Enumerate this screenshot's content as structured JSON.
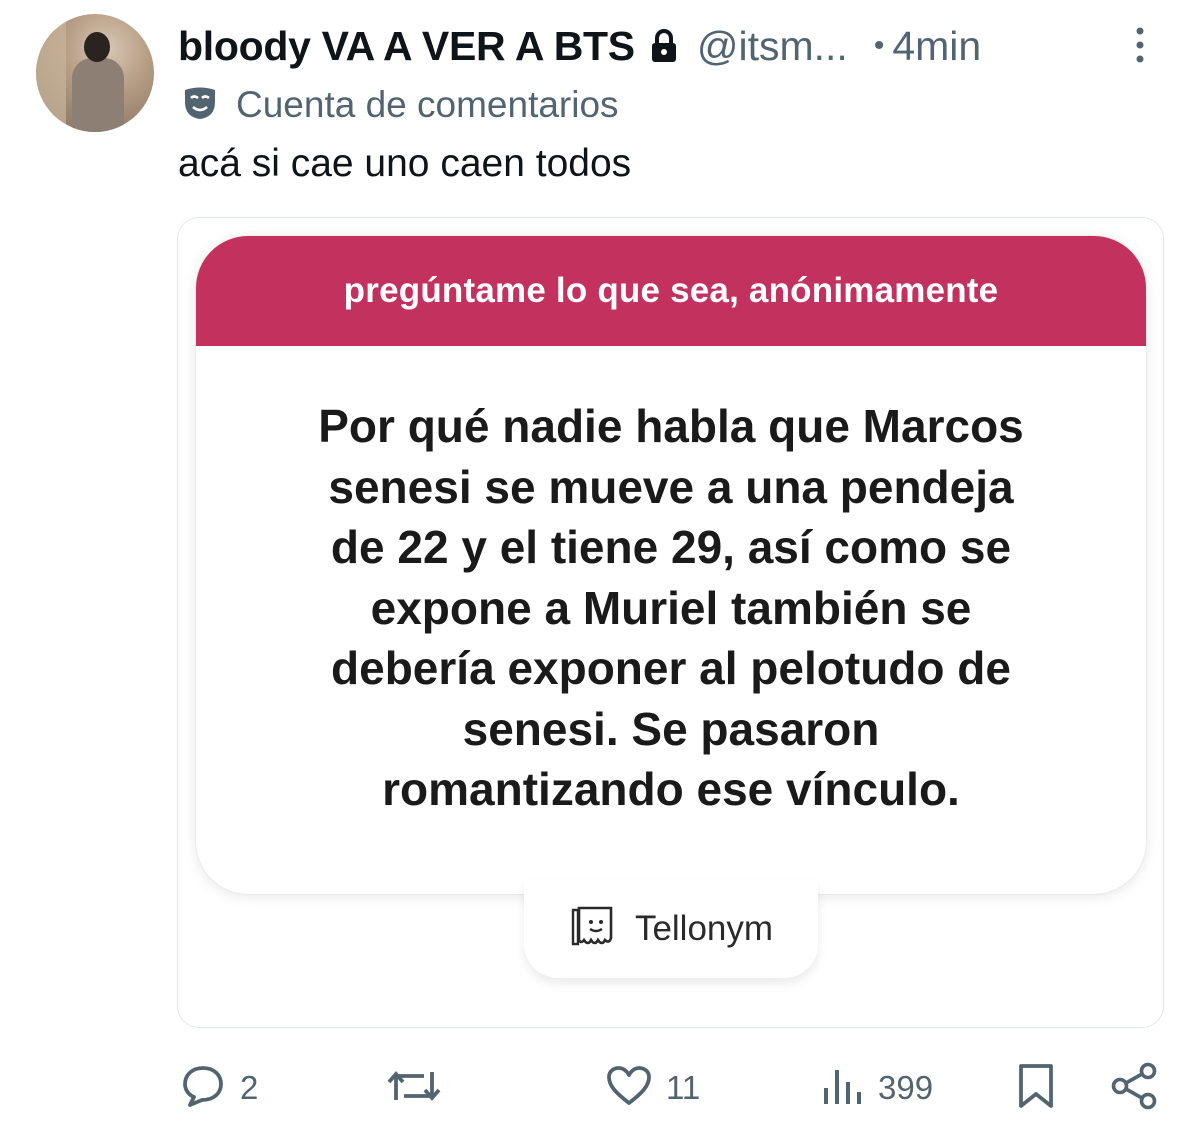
{
  "tweet": {
    "display_name": "bloody VA A VER A BTS",
    "handle": "@itsm...",
    "separator": "•",
    "time": "4min",
    "account_label": "Cuenta de comentarios",
    "text": "acá si cae uno caen todos"
  },
  "tellonym": {
    "banner": "pregúntame lo que sea, anónimamente",
    "question_lines": [
      "Por qué nadie habla que Marcos",
      "senesi se mueve a una pendeja",
      "de 22 y el tiene 29, así como se",
      "expone a Muriel también se",
      "debería exponer al pelotudo de",
      "senesi. Se pasaron",
      "romantizando ese vínculo."
    ],
    "brand": "Tellonym"
  },
  "actions": {
    "replies": "2",
    "retweets": "",
    "likes": "11",
    "views": "399"
  },
  "icons": [
    "lock-icon",
    "more-icon",
    "mask-icon",
    "tellonym-logo-icon",
    "reply-icon",
    "retweet-icon",
    "like-icon",
    "views-icon",
    "bookmark-icon",
    "share-icon"
  ],
  "colors": {
    "banner": "#c3325f",
    "secondary_text": "#536471",
    "primary_text": "#0f1419"
  }
}
